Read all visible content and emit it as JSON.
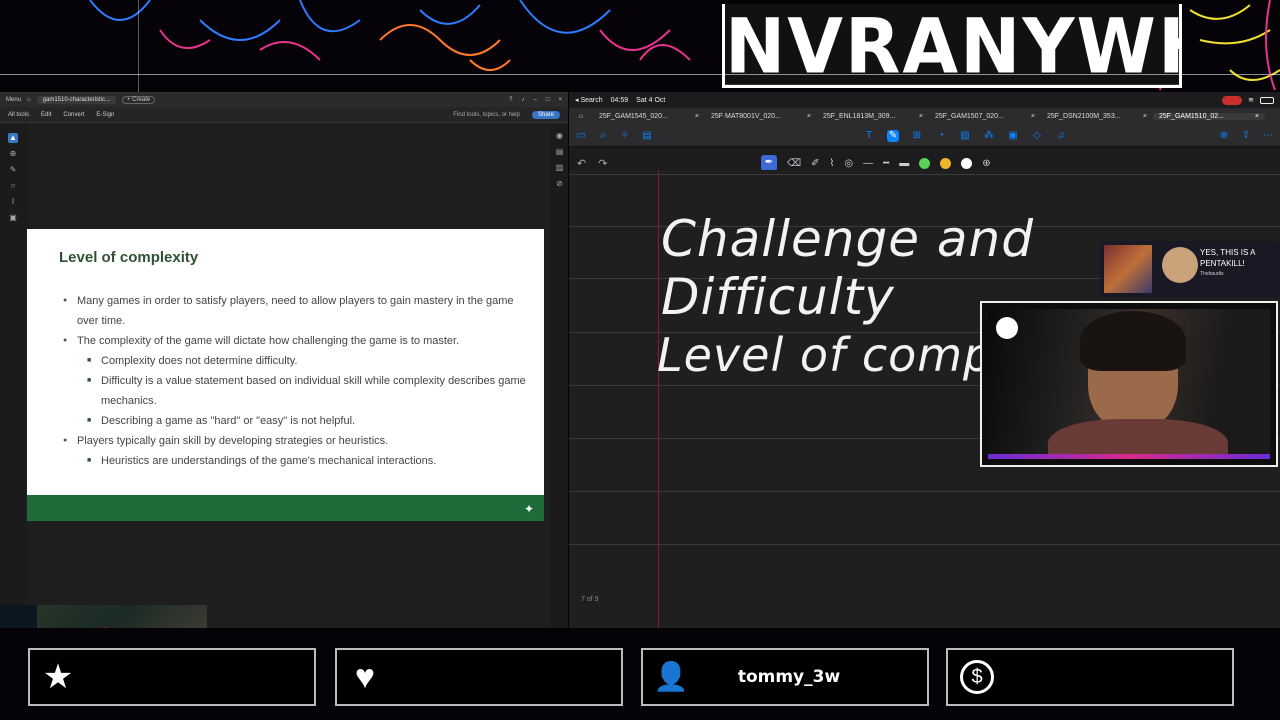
{
  "overlay": {
    "brand": "NVRANYWHR",
    "colors": {
      "neon_pink": "#e8348f",
      "neon_blue": "#2f7bff",
      "neon_orange": "#ff7a2a"
    }
  },
  "acrobat": {
    "menu": "Menu",
    "tab_title": "gam1510-characteristic...",
    "create": "+ Create",
    "menubar": [
      "All tools",
      "Edit",
      "Convert",
      "E-Sign"
    ],
    "find": "Find tools, topics, or help",
    "share": "Share",
    "slide": {
      "title": "Level of complexity",
      "bullets": [
        {
          "level": 1,
          "text": "Many games in order to satisfy players, need to allow players to gain mastery in the game over time."
        },
        {
          "level": 1,
          "text": "The complexity of the game will dictate how challenging the game is to master."
        },
        {
          "level": 2,
          "text": "Complexity does not determine difficulty."
        },
        {
          "level": 2,
          "text": "Difficulty is a value statement based on individual skill while complexity describes game mechanics."
        },
        {
          "level": 2,
          "text": "Describing a game as \"hard\" or \"easy\" is not helpful."
        },
        {
          "level": 1,
          "text": "Players typically gain skill by developing strategies or heuristics."
        },
        {
          "level": 2,
          "text": "Heuristics are understandings of the game's mechanical interactions."
        }
      ],
      "footer_color": "#1f6b3a"
    }
  },
  "ipad": {
    "status": {
      "back": "◂ Search",
      "time": "04:59",
      "date": "Sat 4 Oct"
    },
    "tabs": [
      {
        "label": "25F_GAM1545_020...",
        "active": false
      },
      {
        "label": "25F MAT8001V_020...",
        "active": false
      },
      {
        "label": "25F_ENL1813M_309...",
        "active": false
      },
      {
        "label": "25F_GAM1507_020...",
        "active": false
      },
      {
        "label": "25F_DSN2100M_353...",
        "active": false
      },
      {
        "label": "25F_GAM1510_02...",
        "active": true
      }
    ],
    "note": {
      "line1": "Challenge and Difficulty",
      "line2": "Level of complexity",
      "page_indicator": "7 of 9"
    },
    "swatch_colors": [
      "#5bd15b",
      "#f0b429",
      "#ffffff"
    ]
  },
  "alert": {
    "text": "YES, THIS IS A PENTAKILL!",
    "sub": "Thebaudts"
  },
  "stream_bar": {
    "follow_label": "",
    "sub_label": "",
    "latest_follower": "tommy_3w",
    "donation_label": ""
  }
}
